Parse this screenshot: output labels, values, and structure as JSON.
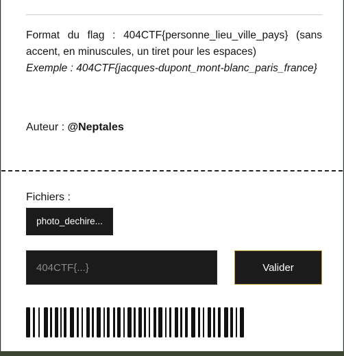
{
  "challenge": {
    "flag_format_text": "Format du flag : 404CTF{personne_lieu_ville_pays} (sans accent, en minuscules, un tiret pour les espaces)",
    "example_text": "Exemple : 404CTF{jacques-dupont_mont-blanc_paris_france}",
    "author_label": "Auteur : ",
    "author_name": "@Neptales"
  },
  "files": {
    "label": "Fichiers :",
    "items": [
      {
        "name": "photo_dechire..."
      }
    ]
  },
  "submission": {
    "input_value": "",
    "input_placeholder": "404CTF{...}",
    "submit_label": "Valider"
  },
  "colors": {
    "dark": "#1b1b1b",
    "accent_border": "#c9a13b"
  }
}
